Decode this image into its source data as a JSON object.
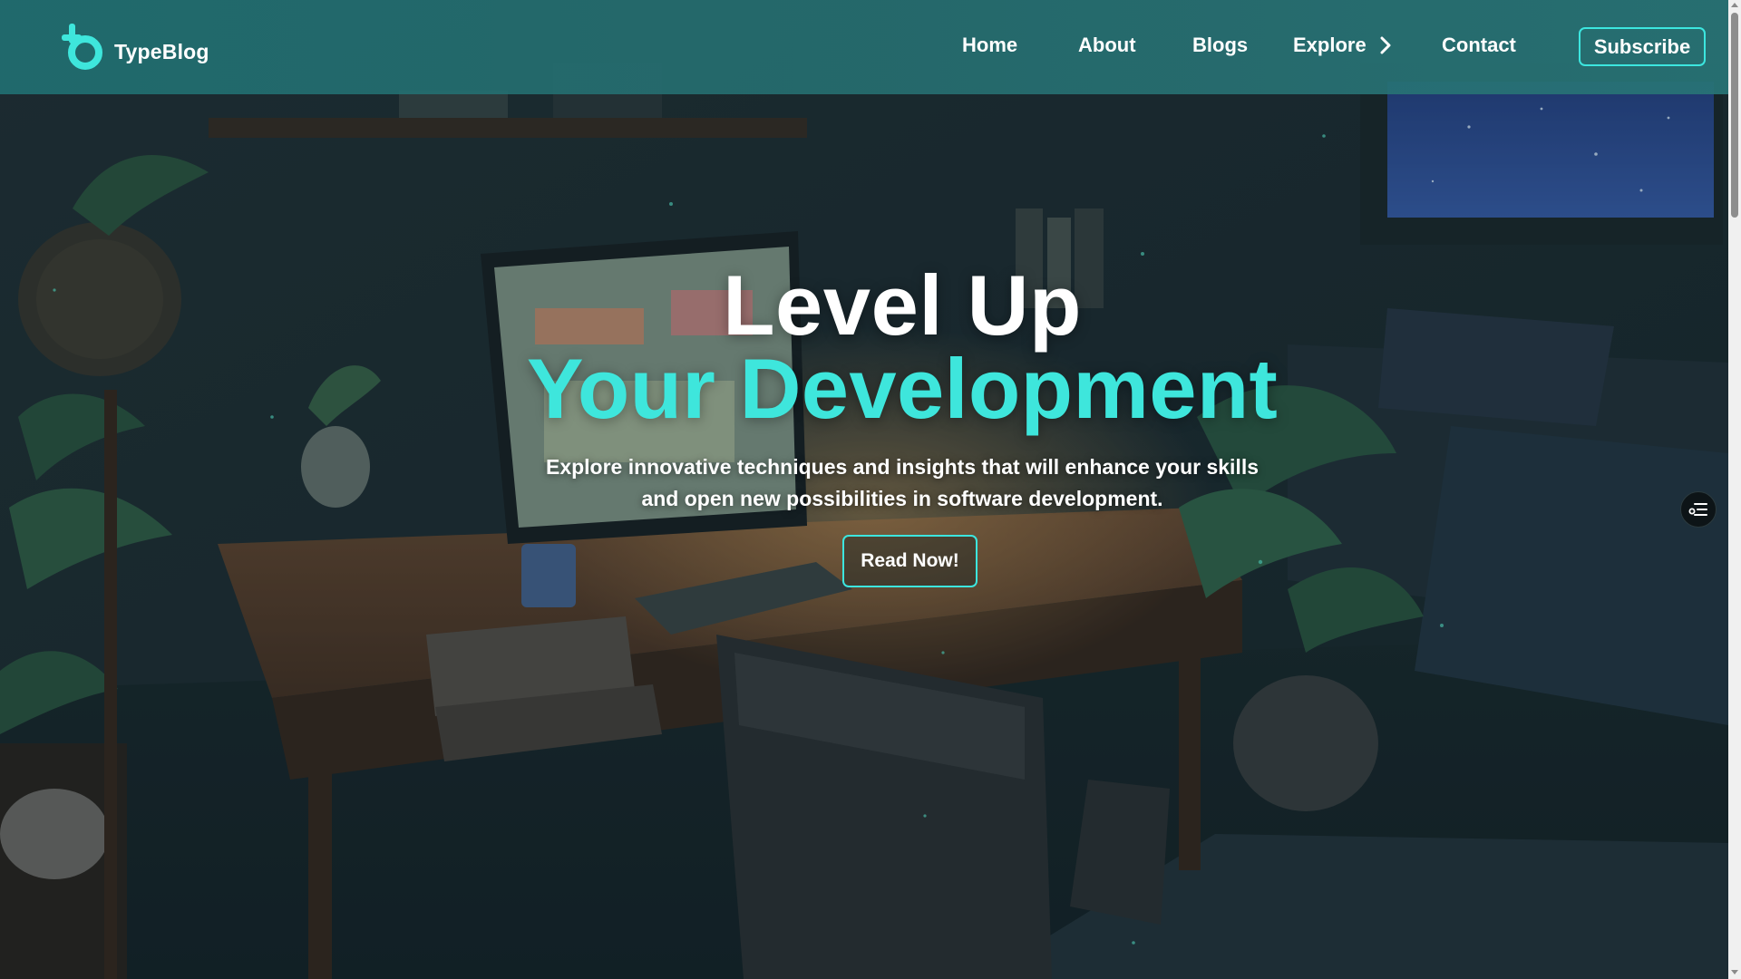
{
  "brand": {
    "name": "TypeBlog",
    "accent_color": "#3ee6dc"
  },
  "nav": {
    "home": "Home",
    "about": "About",
    "blogs": "Blogs",
    "explore": "Explore",
    "contact": "Contact",
    "subscribe": "Subscribe"
  },
  "hero": {
    "title_line1": "Level Up",
    "title_line2": "Your Development",
    "subtitle_line1": "Explore innovative techniques and insights that will enhance your skills",
    "subtitle_line2": "and open new possibilities in software development.",
    "cta": "Read Now!"
  },
  "icons": {
    "logo": "typeblog-logo-icon",
    "explore": "chevron-right-icon",
    "toc": "list-filter-icon"
  }
}
